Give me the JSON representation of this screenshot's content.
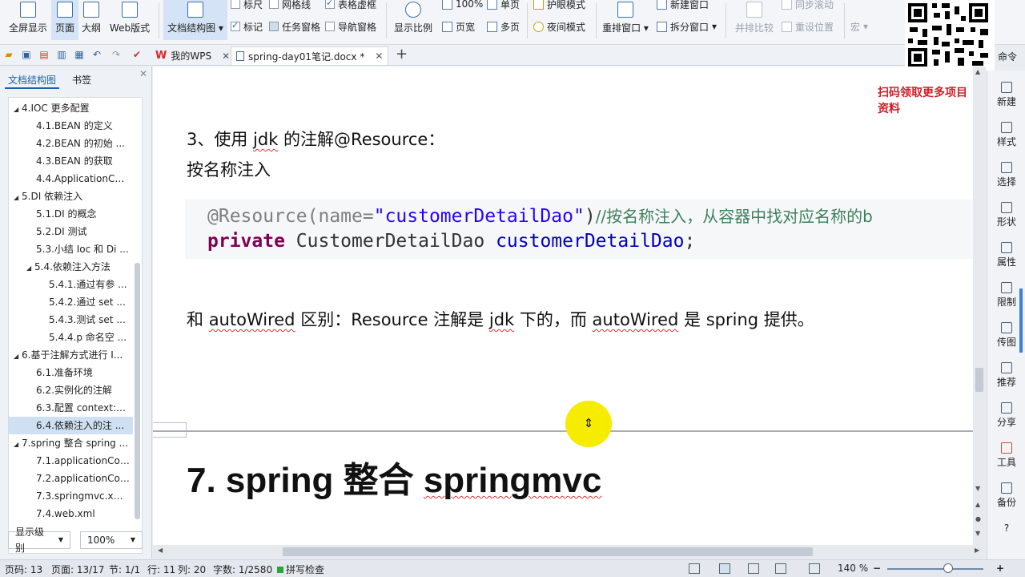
{
  "ribbon": {
    "big_buttons": [
      {
        "label": "全屏显示",
        "icon": "fullscreen-icon"
      },
      {
        "label": "页面",
        "icon": "page-view-icon"
      },
      {
        "label": "大纲",
        "icon": "outline-icon"
      },
      {
        "label": "Web版式",
        "icon": "web-layout-icon"
      },
      {
        "label": "文档结构图",
        "icon": "doc-structure-icon"
      },
      {
        "label": "显示比例",
        "icon": "zoom-icon"
      },
      {
        "label": "重排窗口",
        "icon": "rearrange-window-icon"
      },
      {
        "label": "并排比较",
        "icon": "side-by-side-icon"
      }
    ],
    "top_row": [
      {
        "label": "标尺",
        "checked": false
      },
      {
        "label": "网格线",
        "checked": false
      },
      {
        "label": "表格虚框",
        "checked": true
      },
      {
        "label": "100%"
      },
      {
        "label": "单页"
      },
      {
        "label": "护眼模式"
      },
      {
        "label": "新建窗口"
      },
      {
        "label": "同步滚动"
      }
    ],
    "bottom_row": [
      {
        "label": "标记",
        "checked": true
      },
      {
        "label": "任务窗格",
        "checked": false
      },
      {
        "label": "导航窗格",
        "checked": false
      },
      {
        "label": "页宽"
      },
      {
        "label": "多页"
      },
      {
        "label": "夜间模式"
      },
      {
        "label": "拆分窗口"
      },
      {
        "label": "重设位置"
      },
      {
        "label": "宏"
      }
    ]
  },
  "command_label": "命令",
  "tabs": {
    "home": "我的WPS",
    "document": "spring-day01笔记.docx *",
    "add": "+"
  },
  "nav": {
    "tab_structure": "文档结构图",
    "tab_bookmark": "书签",
    "items": [
      {
        "label": "4.IOC 更多配置",
        "level": 1
      },
      {
        "label": "4.1.BEAN 的定义",
        "level": 2
      },
      {
        "label": "4.2.BEAN 的初始 ...",
        "level": 2
      },
      {
        "label": "4.3.BEAN 的获取",
        "level": 2
      },
      {
        "label": "4.4.ApplicationCo ...",
        "level": 2
      },
      {
        "label": "5.DI 依赖注入",
        "level": 1
      },
      {
        "label": "5.1.DI 的概念",
        "level": 2
      },
      {
        "label": "5.2.DI 测试",
        "level": 2
      },
      {
        "label": "5.3.小结 Ioc 和 Di ...",
        "level": 2
      },
      {
        "label": "5.4.依赖注入方法",
        "level": 2
      },
      {
        "label": "5.4.1.通过有参 ...",
        "level": 3
      },
      {
        "label": "5.4.2.通过 set ...",
        "level": 3
      },
      {
        "label": "5.4.3.测试 set ...",
        "level": 3
      },
      {
        "label": "5.4.4.p 命名空 ...",
        "level": 3
      },
      {
        "label": "6.基于注解方式进行 I...",
        "level": 1
      },
      {
        "label": "6.1.准备环境",
        "level": 2
      },
      {
        "label": "6.2.实例化的注解",
        "level": 2
      },
      {
        "label": "6.3.配置 context:c...",
        "level": 2
      },
      {
        "label": "6.4.依赖注入的注 ...",
        "level": 2
      },
      {
        "label": "7.spring 整合 spring ...",
        "level": 1
      },
      {
        "label": "7.1.applicationCo ...",
        "level": 2
      },
      {
        "label": "7.2.applicationCo ...",
        "level": 2
      },
      {
        "label": "7.3.springmvc.xm ...",
        "level": 2
      },
      {
        "label": "7.4.web.xml",
        "level": 2
      }
    ],
    "display_level": "显示级别",
    "zoom": "100%"
  },
  "document": {
    "scan_note": "扫码领取更多项目资料",
    "line1": {
      "prefix": "3、使用 ",
      "jdk": "jdk",
      "suffix": " 的注解@Resource："
    },
    "line2": "按名称注入",
    "code": {
      "anno": "@Resource(name=",
      "str": "\"customerDetailDao\"",
      "close": ")",
      "comment": "//按名称注入，从容器中找对应名称的b",
      "kw": "private",
      "cls": "CustomerDetailDao",
      "field": "customerDetailDao",
      "end": ";"
    },
    "line3": {
      "p1": "和 ",
      "w1": "autoWired",
      "p2": " 区别：Resource 注解是 ",
      "w2": "jdk",
      "p3": " 下的，而 ",
      "w3": "autoWired",
      "p4": " 是 spring 提供。"
    },
    "heading": {
      "prefix": "7. spring 整合 ",
      "word": "springmvc"
    }
  },
  "rightbar": [
    {
      "label": "新建",
      "icon": "new-icon"
    },
    {
      "label": "样式",
      "icon": "style-icon"
    },
    {
      "label": "选择",
      "icon": "select-icon"
    },
    {
      "label": "形状",
      "icon": "shape-icon"
    },
    {
      "label": "属性",
      "icon": "properties-icon"
    },
    {
      "label": "限制",
      "icon": "restrict-icon"
    },
    {
      "label": "传图",
      "icon": "upload-image-icon"
    },
    {
      "label": "推荐",
      "icon": "recommend-icon"
    },
    {
      "label": "分享",
      "icon": "share-icon"
    },
    {
      "label": "工具",
      "icon": "toolbox-icon"
    },
    {
      "label": "备份",
      "icon": "backup-icon"
    },
    {
      "label": "?",
      "icon": "help-icon"
    }
  ],
  "status": {
    "page_code": "页码: 13",
    "page": "页面: 13/17",
    "section": "节: 1/1",
    "row": "行: 11",
    "col": "列: 20",
    "words": "字数: 1/2580",
    "spell": "拼写检查",
    "zoom": "140 %"
  },
  "colors": {
    "accent": "#1f5fb0",
    "cursor_highlight": "#f5ec00",
    "scan_note": "#d0202a"
  }
}
